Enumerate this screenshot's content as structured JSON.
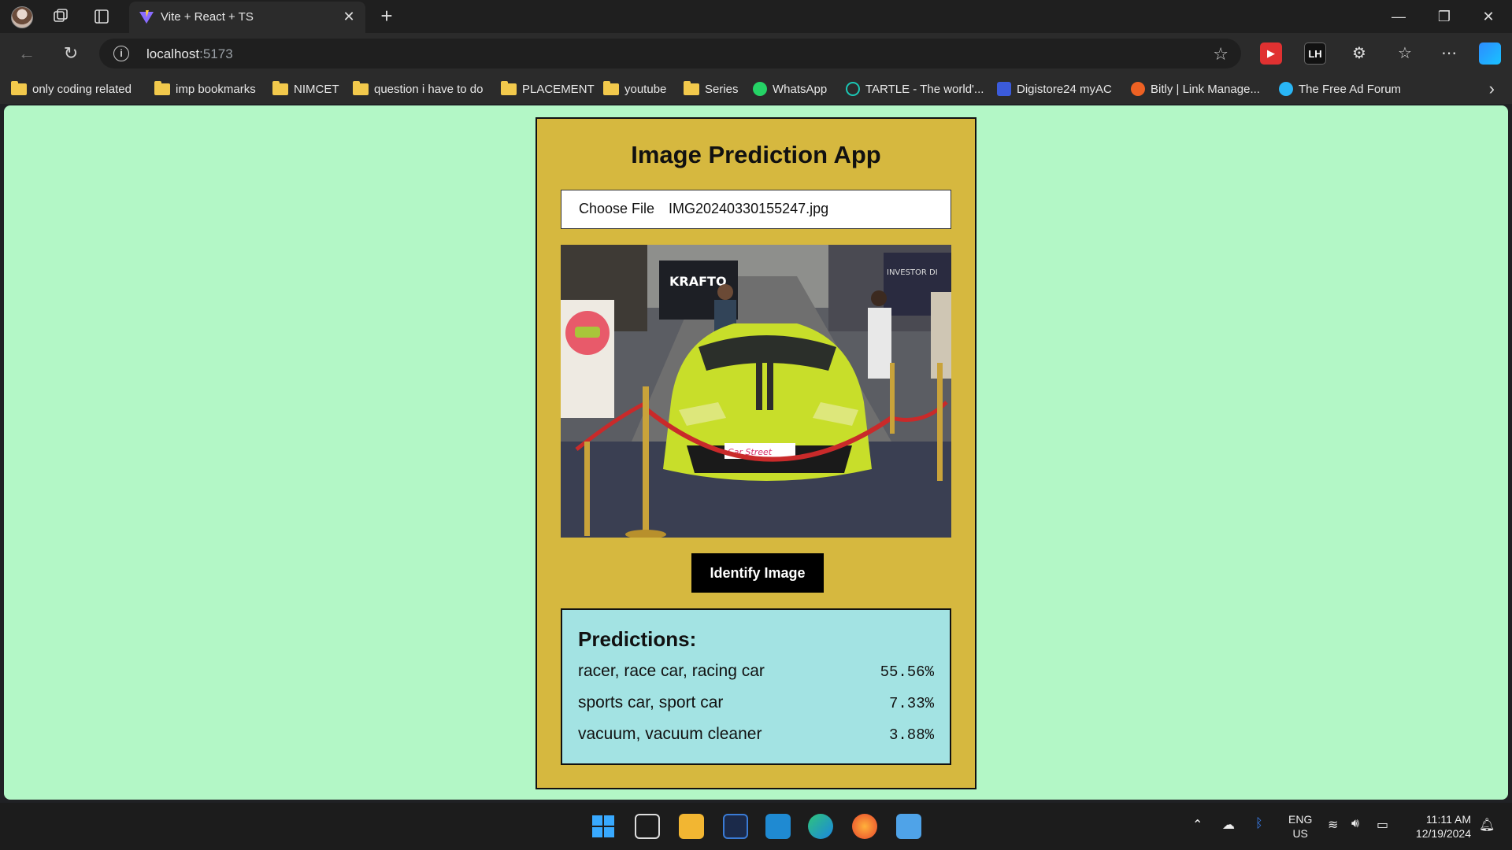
{
  "browser": {
    "tab_title": "Vite + React + TS",
    "url_host": "localhost",
    "url_port": ":5173"
  },
  "bookmarks": [
    {
      "label": "only coding  related",
      "icon": "folder-icon"
    },
    {
      "label": "imp bookmarks",
      "icon": "folder-icon"
    },
    {
      "label": "NIMCET",
      "icon": "folder-icon"
    },
    {
      "label": "question i have to do",
      "icon": "folder-icon"
    },
    {
      "label": "PLACEMENT",
      "icon": "folder-icon"
    },
    {
      "label": "youtube",
      "icon": "folder-icon"
    },
    {
      "label": "Series",
      "icon": "folder-icon"
    },
    {
      "label": "WhatsApp",
      "icon": "whatsapp-icon"
    },
    {
      "label": "TARTLE - The world'...",
      "icon": "tartle-icon"
    },
    {
      "label": "Digistore24 myAC",
      "icon": "digistore-icon"
    },
    {
      "label": "Bitly | Link Manage...",
      "icon": "bitly-icon"
    },
    {
      "label": "The Free Ad Forum",
      "icon": "forum-icon"
    }
  ],
  "app": {
    "title": "Image Prediction App",
    "choose_file_label": "Choose File",
    "file_name": "IMG20240330155247.jpg",
    "identify_label": "Identify Image",
    "predictions_title": "Predictions:",
    "predictions": [
      {
        "label": "racer, race car, racing car",
        "value": "55.56%"
      },
      {
        "label": "sports car, sport car",
        "value": "7.33%"
      },
      {
        "label": "vacuum, vacuum cleaner",
        "value": "3.88%"
      }
    ],
    "photo_signs": {
      "krafto": "KRAFTO",
      "investor": "INVESTOR DI",
      "plate": "Car Street"
    }
  },
  "taskbar": {
    "lang_top": "ENG",
    "lang_bottom": "US",
    "time": "11:11 AM",
    "date": "12/19/2024"
  },
  "colors": {
    "page_bg": "#b3f7c6",
    "card_bg": "#d6b83f",
    "predictions_bg": "#a3e3e3",
    "button_bg": "#000000"
  }
}
